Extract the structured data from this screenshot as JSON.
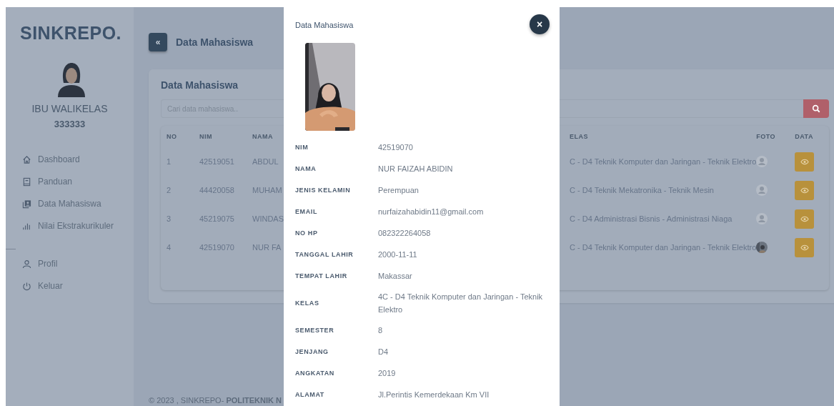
{
  "sidebar": {
    "brand": "SINKREPO.",
    "user_name": "IBU WALIKELAS",
    "user_id": "333333",
    "menu": [
      {
        "label": "Dashboard"
      },
      {
        "label": "Panduan"
      },
      {
        "label": "Data Mahasiswa"
      },
      {
        "label": "Nilai Ekstrakurikuler"
      }
    ],
    "account_menu": [
      {
        "label": "Profil"
      },
      {
        "label": "Keluar"
      }
    ]
  },
  "header": {
    "toggle": "«",
    "title": "Data Mahasiswa"
  },
  "card": {
    "title": "Data Mahasiswa",
    "search": {
      "placeholder": "Cari data mahasiswa.."
    },
    "table": {
      "columns": [
        "NO",
        "NIM",
        "NAMA",
        "ELAS",
        "FOTO",
        "DATA"
      ],
      "rows": [
        {
          "no": "1",
          "nim": "42519051",
          "nama": "ABDUL",
          "kelas": "C - D4 Teknik Komputer dan Jaringan - Teknik Elektro",
          "kind": "no_photo"
        },
        {
          "no": "2",
          "nim": "44420058",
          "nama": "MUHAM",
          "kelas": "C - D4 Teknik Mekatronika - Teknik Mesin",
          "kind": "no_photo"
        },
        {
          "no": "3",
          "nim": "45219075",
          "nama": "WINDAS",
          "kelas": "C - D4 Administrasi Bisnis - Administrasi Niaga",
          "kind": "no_photo"
        },
        {
          "no": "4",
          "nim": "42519070",
          "nama": "NUR FA",
          "kelas": "C - D4 Teknik Komputer dan Jaringan - Teknik Elektro"
        }
      ]
    }
  },
  "footer": "© 2023 , SINKREPO- **POLITEKNIK N**",
  "modal": {
    "title": "Data Mahasiswa",
    "close": "×",
    "fields": [
      {
        "label": "NIM",
        "value": "42519070"
      },
      {
        "label": "NAMA",
        "value": "NUR FAIZAH ABIDIN"
      },
      {
        "label": "JENIS KELAMIN",
        "value": "Perempuan"
      },
      {
        "label": "EMAIL",
        "value": "nurfaizahabidin11@gmail.com"
      },
      {
        "label": "NO HP",
        "value": "082322264058"
      },
      {
        "label": "TANGGAL LAHIR",
        "value": "2000-11-11"
      },
      {
        "label": "TEMPAT LAHIR",
        "value": "Makassar"
      },
      {
        "label": "KELAS",
        "value": "4C - D4 Teknik Komputer dan Jaringan - Teknik Elektro"
      },
      {
        "label": "SEMESTER",
        "value": "8"
      },
      {
        "label": "JENJANG",
        "value": "D4"
      },
      {
        "label": "ANGKATAN",
        "value": "2019"
      },
      {
        "label": "ALAMAT",
        "value": "Jl.Perintis Kemerdekaan Km VII"
      }
    ]
  }
}
